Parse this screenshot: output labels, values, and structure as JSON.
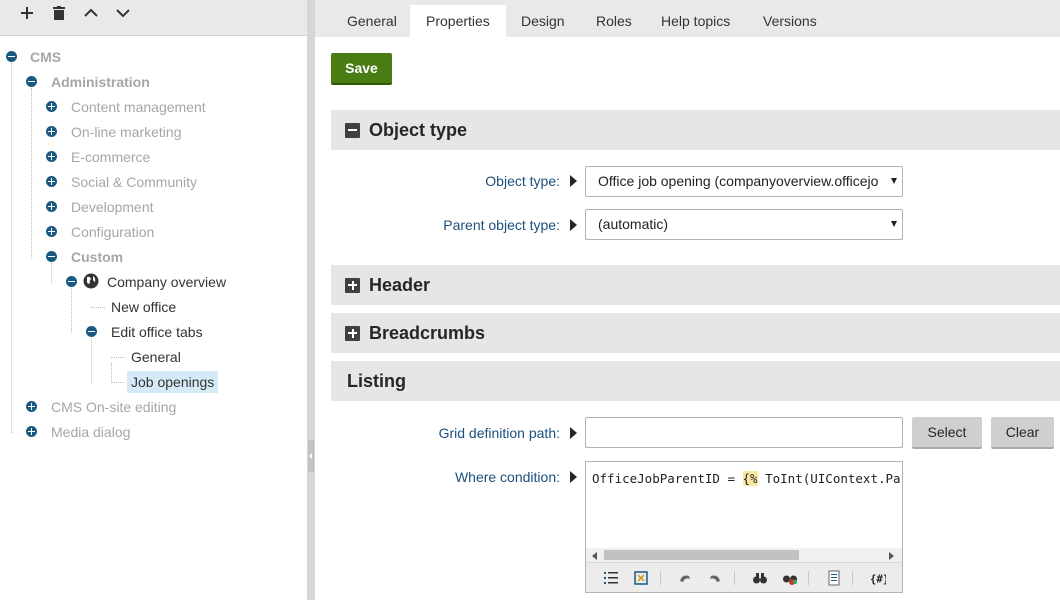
{
  "toolbar": {
    "icons": [
      "plus-icon",
      "trash-icon",
      "chevron-up-icon",
      "chevron-down-icon"
    ]
  },
  "tree": {
    "root": "CMS",
    "administration": "Administration",
    "content_management": "Content management",
    "online_marketing": "On-line marketing",
    "ecommerce": "E-commerce",
    "social_community": "Social & Community",
    "development": "Development",
    "configuration": "Configuration",
    "custom": "Custom",
    "company_overview": "Company overview",
    "new_office": "New office",
    "edit_office_tabs": "Edit office tabs",
    "general": "General",
    "job_openings": "Job openings",
    "cms_onsite_editing": "CMS On-site editing",
    "media_dialog": "Media dialog"
  },
  "tabs": [
    {
      "label": "General"
    },
    {
      "label": "Properties",
      "active": true
    },
    {
      "label": "Design"
    },
    {
      "label": "Roles"
    },
    {
      "label": "Help topics"
    },
    {
      "label": "Versions"
    }
  ],
  "main": {
    "save_label": "Save",
    "object_type_section": {
      "title": "Object type",
      "object_type_label": "Object type:",
      "object_type_value": "Office job opening (companyoverview.officejo",
      "parent_object_type_label": "Parent object type:",
      "parent_object_type_value": "(automatic)"
    },
    "header_section": {
      "title": "Header"
    },
    "breadcrumbs_section": {
      "title": "Breadcrumbs"
    },
    "listing_section": {
      "title": "Listing",
      "grid_definition_label": "Grid definition path:",
      "grid_definition_value": "",
      "select_label": "Select",
      "clear_label": "Clear",
      "where_condition_label": "Where condition:",
      "where_code_prefix": "OfficeJobParentID = ",
      "where_code_macro_open": "{%",
      "where_code_suffix": " ToInt(UIContext.Pa"
    }
  },
  "colors": {
    "save_button": "#497d13",
    "tree_toggle": "#1a5a82",
    "field_label": "#1c4f7c",
    "selected_node": "#d4eaf7",
    "section_bg": "#e6e6e6"
  }
}
